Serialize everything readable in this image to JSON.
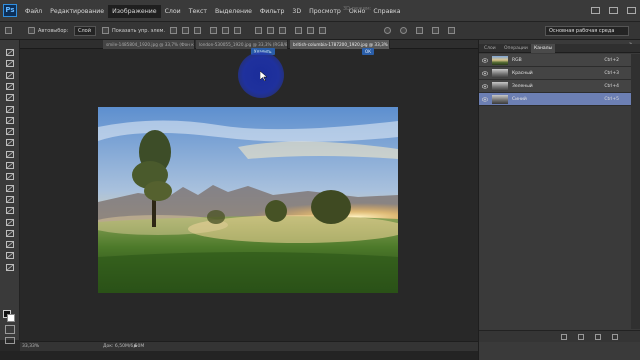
{
  "menubar": {
    "logo": "Ps",
    "items": [
      "Файл",
      "Редактирование",
      "Изображение",
      "Слои",
      "Текст",
      "Выделение",
      "Фильтр",
      "3D",
      "Просмотр",
      "Окно",
      "Справка"
    ],
    "active_index": 2,
    "mode_3d": "3D-режим:"
  },
  "options_bar": {
    "autoselect_label": "Автовыбор:",
    "autoselect_value": "Слой",
    "show_controls_label": "Показать упр. элем.",
    "workspace": "Основная рабочая среда"
  },
  "document_tabs": [
    {
      "label": "smile-1485804_1920.jpg @ 33,7% (Фон копировать, Красный/8)",
      "active": false
    },
    {
      "label": "london-530055_1920.jpg @ 33,3% (RGB/8)",
      "active": false
    },
    {
      "label": "british-columbia-1787200_1920.jpg @ 33,3% (Синий/8)",
      "active": true
    }
  ],
  "canvas_chips": {
    "left": "Удалить",
    "right": "ОК"
  },
  "status_bar": {
    "zoom": "33,33%",
    "doc": "Док: 6,50M/6,50M",
    "arrow": "▶"
  },
  "panel": {
    "tabs": [
      "Слои",
      "Операции",
      "Каналы"
    ],
    "active_tab": 2,
    "channels": [
      {
        "name": "RGB",
        "shortcut": "Ctrl+2",
        "selected": false,
        "thumb": "color"
      },
      {
        "name": "Красный",
        "shortcut": "Ctrl+3",
        "selected": false,
        "thumb": "gray"
      },
      {
        "name": "Зеленый",
        "shortcut": "Ctrl+4",
        "selected": false,
        "thumb": "gray"
      },
      {
        "name": "Синий",
        "shortcut": "Ctrl+5",
        "selected": true,
        "thumb": "gray"
      }
    ]
  },
  "colors": {
    "menubar": "#3a3a3a",
    "selection": "#6c7fb3",
    "accent": "#2f8fe0"
  },
  "icons": [
    "move-tool-icon",
    "marquee-tool-icon",
    "lasso-tool-icon",
    "quick-select-icon",
    "crop-tool-icon",
    "eyedropper-icon",
    "healing-brush-icon",
    "brush-tool-icon",
    "clone-stamp-icon",
    "history-brush-icon",
    "eraser-icon",
    "gradient-icon",
    "blur-icon",
    "dodge-icon",
    "pen-tool-icon",
    "text-tool-icon",
    "path-select-icon",
    "shape-tool-icon",
    "hand-tool-icon",
    "zoom-tool-icon"
  ]
}
